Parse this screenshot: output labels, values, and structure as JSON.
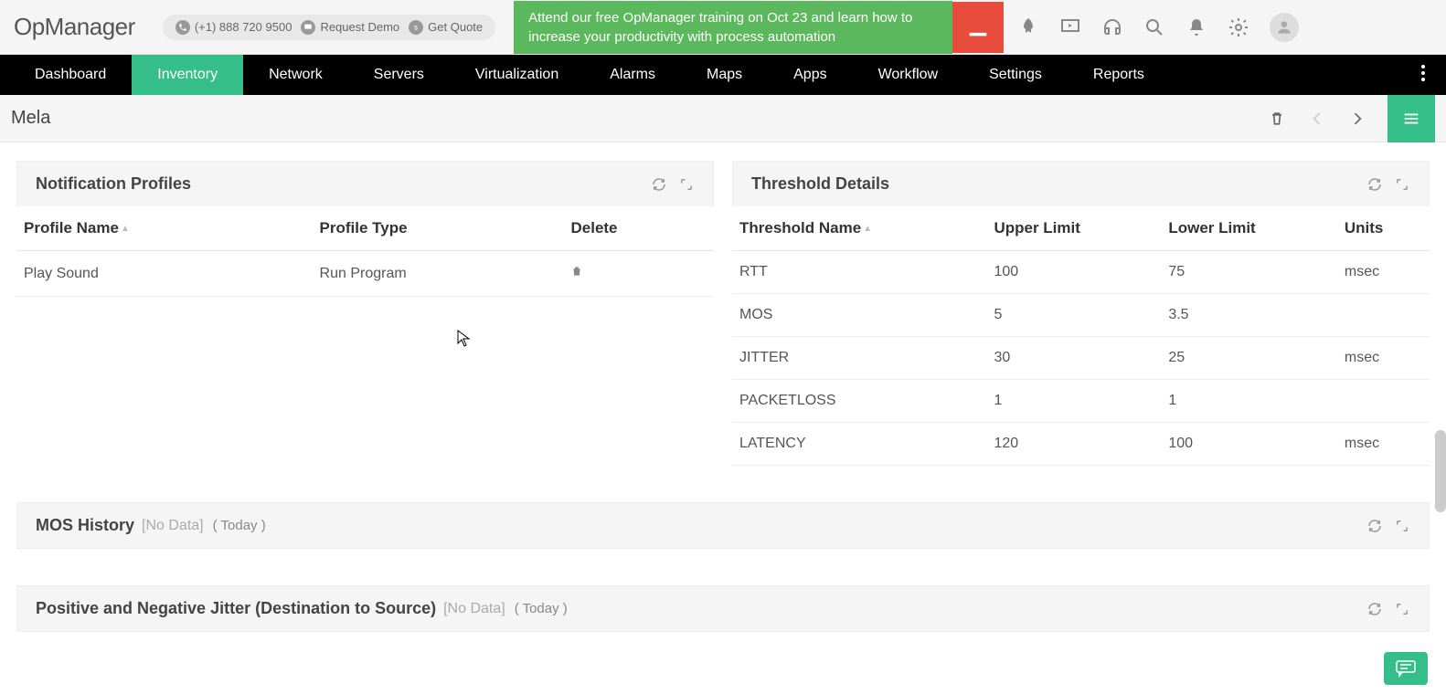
{
  "header": {
    "logo": "OpManager",
    "phone": "(+1) 888 720 9500",
    "demo_label": "Request Demo",
    "quote_label": "Get Quote",
    "training_text": "Attend our free OpManager training on Oct 23 and learn how to increase your productivity with process automation"
  },
  "nav": {
    "items": [
      "Dashboard",
      "Inventory",
      "Network",
      "Servers",
      "Virtualization",
      "Alarms",
      "Maps",
      "Apps",
      "Workflow",
      "Settings",
      "Reports"
    ],
    "active": "Inventory"
  },
  "crumb": {
    "title": "Mela"
  },
  "notification_panel": {
    "title": "Notification Profiles",
    "columns": [
      "Profile Name",
      "Profile Type",
      "Delete"
    ],
    "rows": [
      {
        "name": "Play Sound",
        "type": "Run Program"
      }
    ]
  },
  "threshold_panel": {
    "title": "Threshold Details",
    "columns": [
      "Threshold Name",
      "Upper Limit",
      "Lower Limit",
      "Units"
    ],
    "rows": [
      {
        "name": "RTT",
        "upper": "100",
        "lower": "75",
        "units": "msec"
      },
      {
        "name": "MOS",
        "upper": "5",
        "lower": "3.5",
        "units": ""
      },
      {
        "name": "JITTER",
        "upper": "30",
        "lower": "25",
        "units": "msec"
      },
      {
        "name": "PACKETLOSS",
        "upper": "1",
        "lower": "1",
        "units": ""
      },
      {
        "name": "LATENCY",
        "upper": "120",
        "lower": "100",
        "units": "msec"
      }
    ]
  },
  "sections": [
    {
      "title": "MOS History",
      "nodata": "[No Data]",
      "period": "( Today )"
    },
    {
      "title": "Positive and Negative Jitter (Destination to Source)",
      "nodata": "[No Data]",
      "period": "( Today )"
    }
  ]
}
